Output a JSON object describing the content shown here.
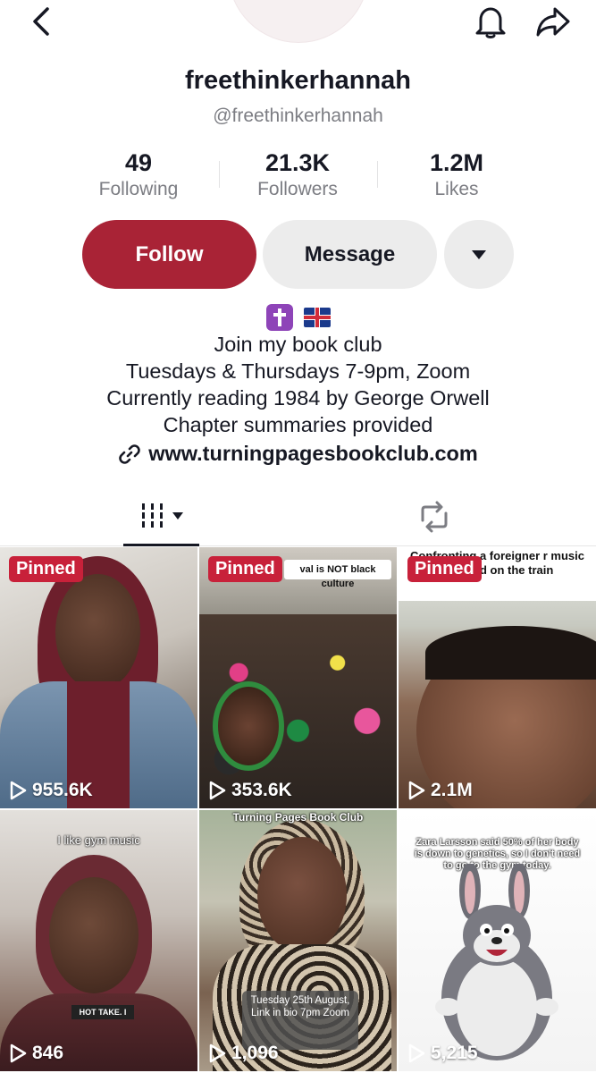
{
  "profile": {
    "display_name": "freethinkerhannah",
    "handle": "@freethinkerhannah"
  },
  "stats": [
    {
      "value": "49",
      "label": "Following"
    },
    {
      "value": "21.3K",
      "label": "Followers"
    },
    {
      "value": "1.2M",
      "label": "Likes"
    }
  ],
  "actions": {
    "follow": "Follow",
    "message": "Message"
  },
  "bio": {
    "emojis": [
      "latin-cross-emoji",
      "uk-flag-emoji"
    ],
    "lines": [
      "Join my book club",
      "Tuesdays & Thursdays 7-9pm, Zoom",
      "Currently reading 1984 by George Orwell",
      "Chapter summaries provided"
    ],
    "link": "www.turningpagesbookclub.com"
  },
  "tabs": {
    "videos_icon": "grid-icon",
    "reposts_icon": "repost-icon"
  },
  "videos": [
    {
      "pinned": "Pinned",
      "views": "955.6K",
      "caption": ""
    },
    {
      "pinned": "Pinned",
      "views": "353.6K",
      "caption": "val is NOT black culture"
    },
    {
      "pinned": "Pinned",
      "views": "2.1M",
      "caption": "Confronting a foreigner r music out loud on the train"
    },
    {
      "pinned": "",
      "views": "846",
      "caption": "I like gym music",
      "caption2": "HOT TAKE. I"
    },
    {
      "pinned": "",
      "views": "1,096",
      "caption": "Turning Pages Book Club",
      "caption2": "Tuesday 25th August, Link in bio 7pm Zoom"
    },
    {
      "pinned": "",
      "views": "5,215",
      "caption": "Zara Larsson said 50% of her body is down to genetics, so I don't need to go to the gym today."
    }
  ],
  "colors": {
    "accent": "#a92336",
    "pinned_badge": "#c8213a",
    "secondary_button": "#ececec"
  }
}
